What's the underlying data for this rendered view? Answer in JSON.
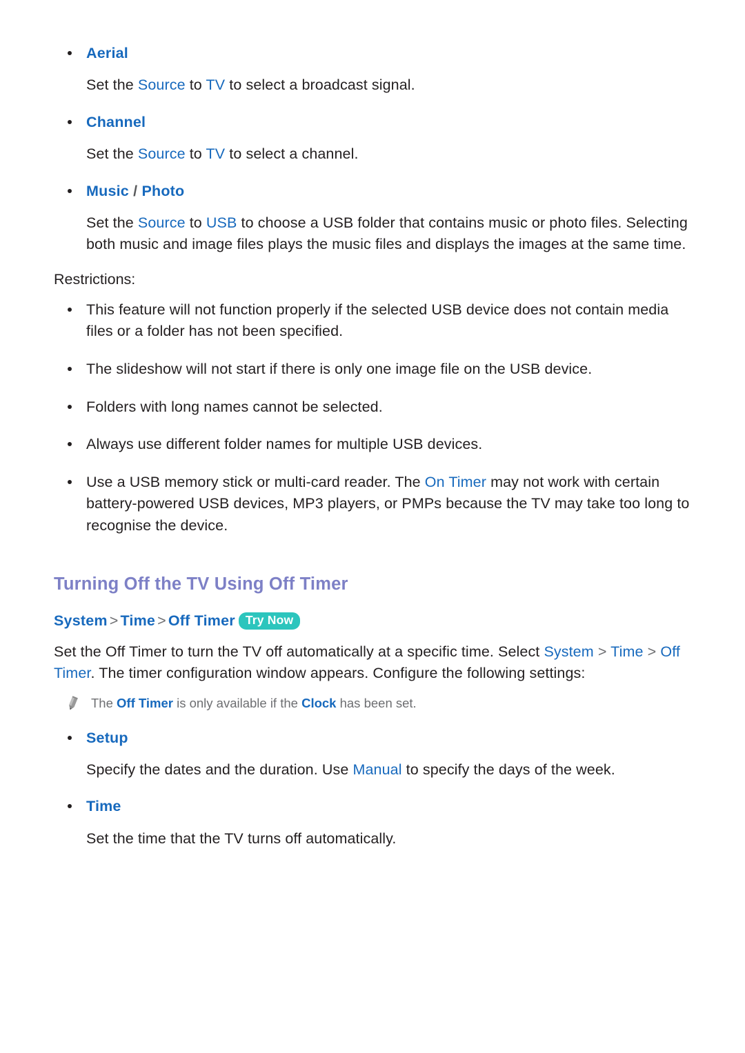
{
  "document": {
    "source_sections": [
      {
        "id": "aerial",
        "title": "Aerial",
        "desc_prefix": "Set the ",
        "kw1": "Source",
        "desc_mid": " to ",
        "kw2": "TV",
        "desc_suffix": " to select a broadcast signal."
      },
      {
        "id": "channel",
        "title": "Channel",
        "desc_prefix": "Set the ",
        "kw1": "Source",
        "desc_mid": " to ",
        "kw2": "TV",
        "desc_suffix": " to select a channel."
      },
      {
        "id": "music-photo",
        "title_part1": "Music",
        "title_slash": " / ",
        "title_part2": "Photo",
        "desc_prefix": "Set the ",
        "kw1": "Source",
        "desc_mid": " to ",
        "kw2": "USB",
        "desc_suffix": " to choose a USB folder that contains music or photo files. Selecting both music and image files plays the music files and displays the images at the same time."
      }
    ],
    "restrictions": {
      "label": "Restrictions:",
      "items": [
        {
          "text": "This feature will not function properly if the selected USB device does not contain media files or a folder has not been specified."
        },
        {
          "text": "The slideshow will not start if there is only one image file on the USB device."
        },
        {
          "text": "Folders with long names cannot be selected."
        },
        {
          "text": "Always use different folder names for multiple USB devices."
        },
        {
          "prefix": "Use a USB memory stick or multi-card reader. The ",
          "kw": "On Timer",
          "suffix": " may not work with certain battery-powered USB devices, MP3 players, or PMPs because the TV may take too long to recognise the device."
        }
      ]
    },
    "off_timer_section": {
      "heading": "Turning Off the TV Using Off Timer",
      "breadcrumb": {
        "item1": "System",
        "sep1": ">",
        "item2": "Time",
        "sep2": ">",
        "item3": "Off Timer",
        "badge": "Try Now"
      },
      "intro": {
        "part1": "Set the Off Timer to turn the TV off automatically at a specific time. Select ",
        "kw1": "System",
        "sep1": " > ",
        "kw2": "Time",
        "sep2": " > ",
        "kw3": "Off Timer",
        "part2": ". The timer configuration window appears. Configure the following settings:"
      },
      "note": {
        "icon": "pencil-icon",
        "prefix": "The ",
        "kw1": "Off Timer",
        "mid": " is only available if the ",
        "kw2": "Clock",
        "suffix": " has been set."
      },
      "settings": [
        {
          "id": "setup",
          "title": "Setup",
          "desc_prefix": "Specify the dates and the duration. Use ",
          "kw": "Manual",
          "desc_suffix": " to specify the days of the week."
        },
        {
          "id": "time",
          "title": "Time",
          "desc_prefix": "Set the time that the TV turns off automatically.",
          "kw": "",
          "desc_suffix": ""
        }
      ]
    },
    "colors": {
      "keyword_blue": "#1769bd",
      "heading_purple": "#7d80c6",
      "badge_teal": "#2cc5bd",
      "body_black": "#231f20",
      "note_gray": "#6d6e71"
    }
  }
}
